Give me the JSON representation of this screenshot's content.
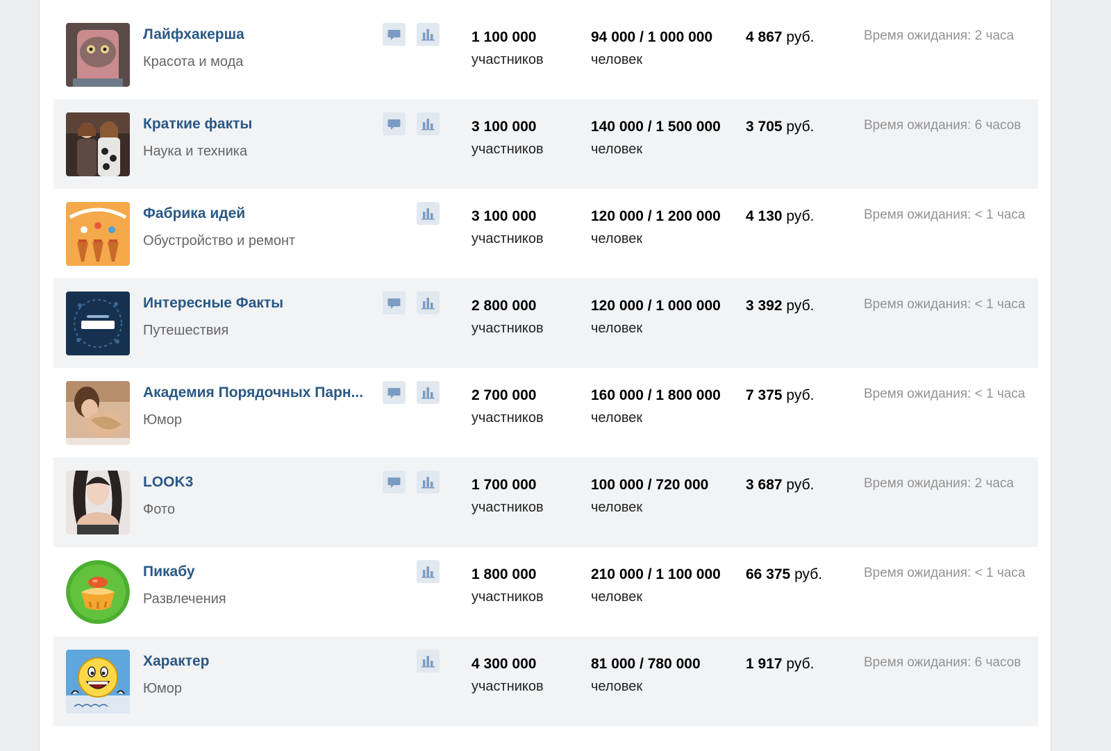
{
  "accent_color": "#2a5885",
  "icons": {
    "message": "message-icon",
    "stats": "bar-chart-icon"
  },
  "communities": [
    {
      "name": "Лайфхакерша",
      "category": "Красота и мода",
      "members": "1 100 000",
      "members_label": "участников",
      "reach": "94 000 / 1 000 000",
      "reach_label": "человек",
      "price": "4 867",
      "currency": " руб.",
      "wait": "Время ожидания: 2 часа",
      "has_message_button": true
    },
    {
      "name": "Краткие факты",
      "category": "Наука и техника",
      "members": "3 100 000",
      "members_label": "участников",
      "reach": "140 000 / 1 500 000",
      "reach_label": "человек",
      "price": "3 705",
      "currency": " руб.",
      "wait": "Время ожидания: 6 часов",
      "has_message_button": true
    },
    {
      "name": "Фабрика идей",
      "category": "Обустройство и ремонт",
      "members": "3 100 000",
      "members_label": "участников",
      "reach": "120 000 / 1 200 000",
      "reach_label": "человек",
      "price": "4 130",
      "currency": " руб.",
      "wait": "Время ожидания: < 1 часа",
      "has_message_button": false
    },
    {
      "name": "Интересные Факты",
      "category": "Путешествия",
      "members": "2 800 000",
      "members_label": "участников",
      "reach": "120 000 / 1 000 000",
      "reach_label": "человек",
      "price": "3 392",
      "currency": " руб.",
      "wait": "Время ожидания: < 1 часа",
      "has_message_button": true
    },
    {
      "name": "Академия Порядочных Парн...",
      "category": "Юмор",
      "members": "2 700 000",
      "members_label": "участников",
      "reach": "160 000 / 1 800 000",
      "reach_label": "человек",
      "price": "7 375",
      "currency": " руб.",
      "wait": "Время ожидания: < 1 часа",
      "has_message_button": true
    },
    {
      "name": "LOOK3",
      "category": "Фото",
      "members": "1 700 000",
      "members_label": "участников",
      "reach": "100 000 / 720 000",
      "reach_label": "человек",
      "price": "3 687",
      "currency": " руб.",
      "wait": "Время ожидания: 2 часа",
      "has_message_button": true
    },
    {
      "name": "Пикабу",
      "category": "Развлечения",
      "members": "1 800 000",
      "members_label": "участников",
      "reach": "210 000 / 1 100 000",
      "reach_label": "человек",
      "price": "66 375",
      "currency": " руб.",
      "wait": "Время ожидания: < 1 часа",
      "has_message_button": false
    },
    {
      "name": "Характер",
      "category": "Юмор",
      "members": "4 300 000",
      "members_label": "участников",
      "reach": "81 000 / 780 000",
      "reach_label": "человек",
      "price": "1 917",
      "currency": " руб.",
      "wait": "Время ожидания: 6 часов",
      "has_message_button": false
    }
  ]
}
